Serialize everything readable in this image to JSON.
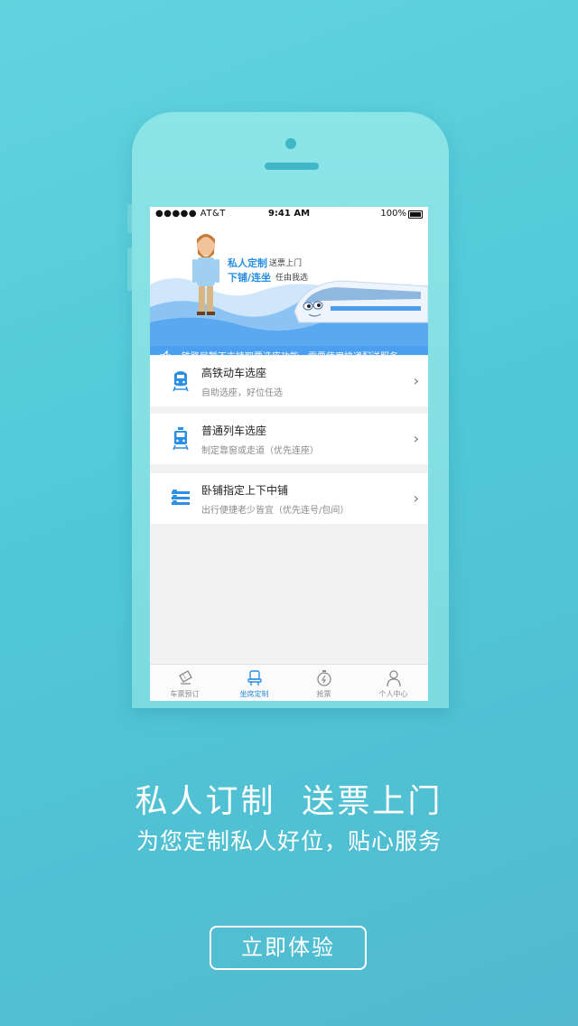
{
  "status_bar": {
    "carrier": "●●●●● AT&T",
    "time": "9:41 AM",
    "battery": "100%"
  },
  "banner": {
    "line1_bold": "私人定制",
    "line1_small": "送票上门",
    "line2_bold": "下铺/连坐",
    "line2_small": "任由我选",
    "notice": "铁路局暂不支持取票选座功能，需要使用快递配送服务"
  },
  "options": [
    {
      "title": "高铁动车选座",
      "subtitle": "自助选座，好位任选",
      "icon": "bullet-train-icon"
    },
    {
      "title": "普通列车选座",
      "subtitle": "制定靠窗或走道（优先连座）",
      "icon": "train-icon"
    },
    {
      "title": "卧铺指定上下中铺",
      "subtitle": "出行便捷老少皆宜（优先连号/包间）",
      "icon": "berth-icon"
    }
  ],
  "tabs": [
    {
      "label": "车票预订",
      "icon": "ticket-icon"
    },
    {
      "label": "坐席定制",
      "icon": "seat-icon",
      "active": true
    },
    {
      "label": "抢票",
      "icon": "stopwatch-icon"
    },
    {
      "label": "个人中心",
      "icon": "person-icon"
    }
  ],
  "promo": {
    "headline": "私人订制  送票上门",
    "subheadline": "为您定制私人好位，贴心服务",
    "cta": "立即体验"
  },
  "colors": {
    "accent": "#2b8fe3",
    "notice_bg": "#4a9ff0",
    "background": "#55c8d8"
  }
}
